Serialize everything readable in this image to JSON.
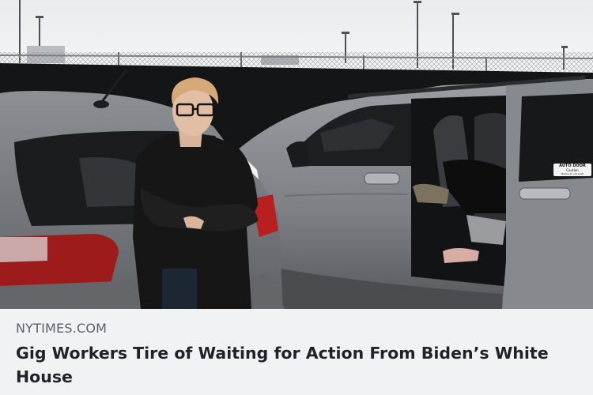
{
  "link_preview": {
    "domain": "NYTIMES.COM",
    "headline": "Gig Workers Tire of Waiting for Action From Biden’s White House",
    "image_alt": "Photo of a woman with glasses and a black jacket leaning against a silver car in a parking lot beside a gray minivan with its sliding door open"
  },
  "photo_text": {
    "door_sticker_line1": "AUTO DOOR",
    "door_sticker_line2": "Caution",
    "door_sticker_line3": "Please do not push"
  },
  "colors": {
    "caption_bg": "#f1f2f4",
    "domain_text": "#5b6068",
    "headline_text": "#1f2329"
  }
}
